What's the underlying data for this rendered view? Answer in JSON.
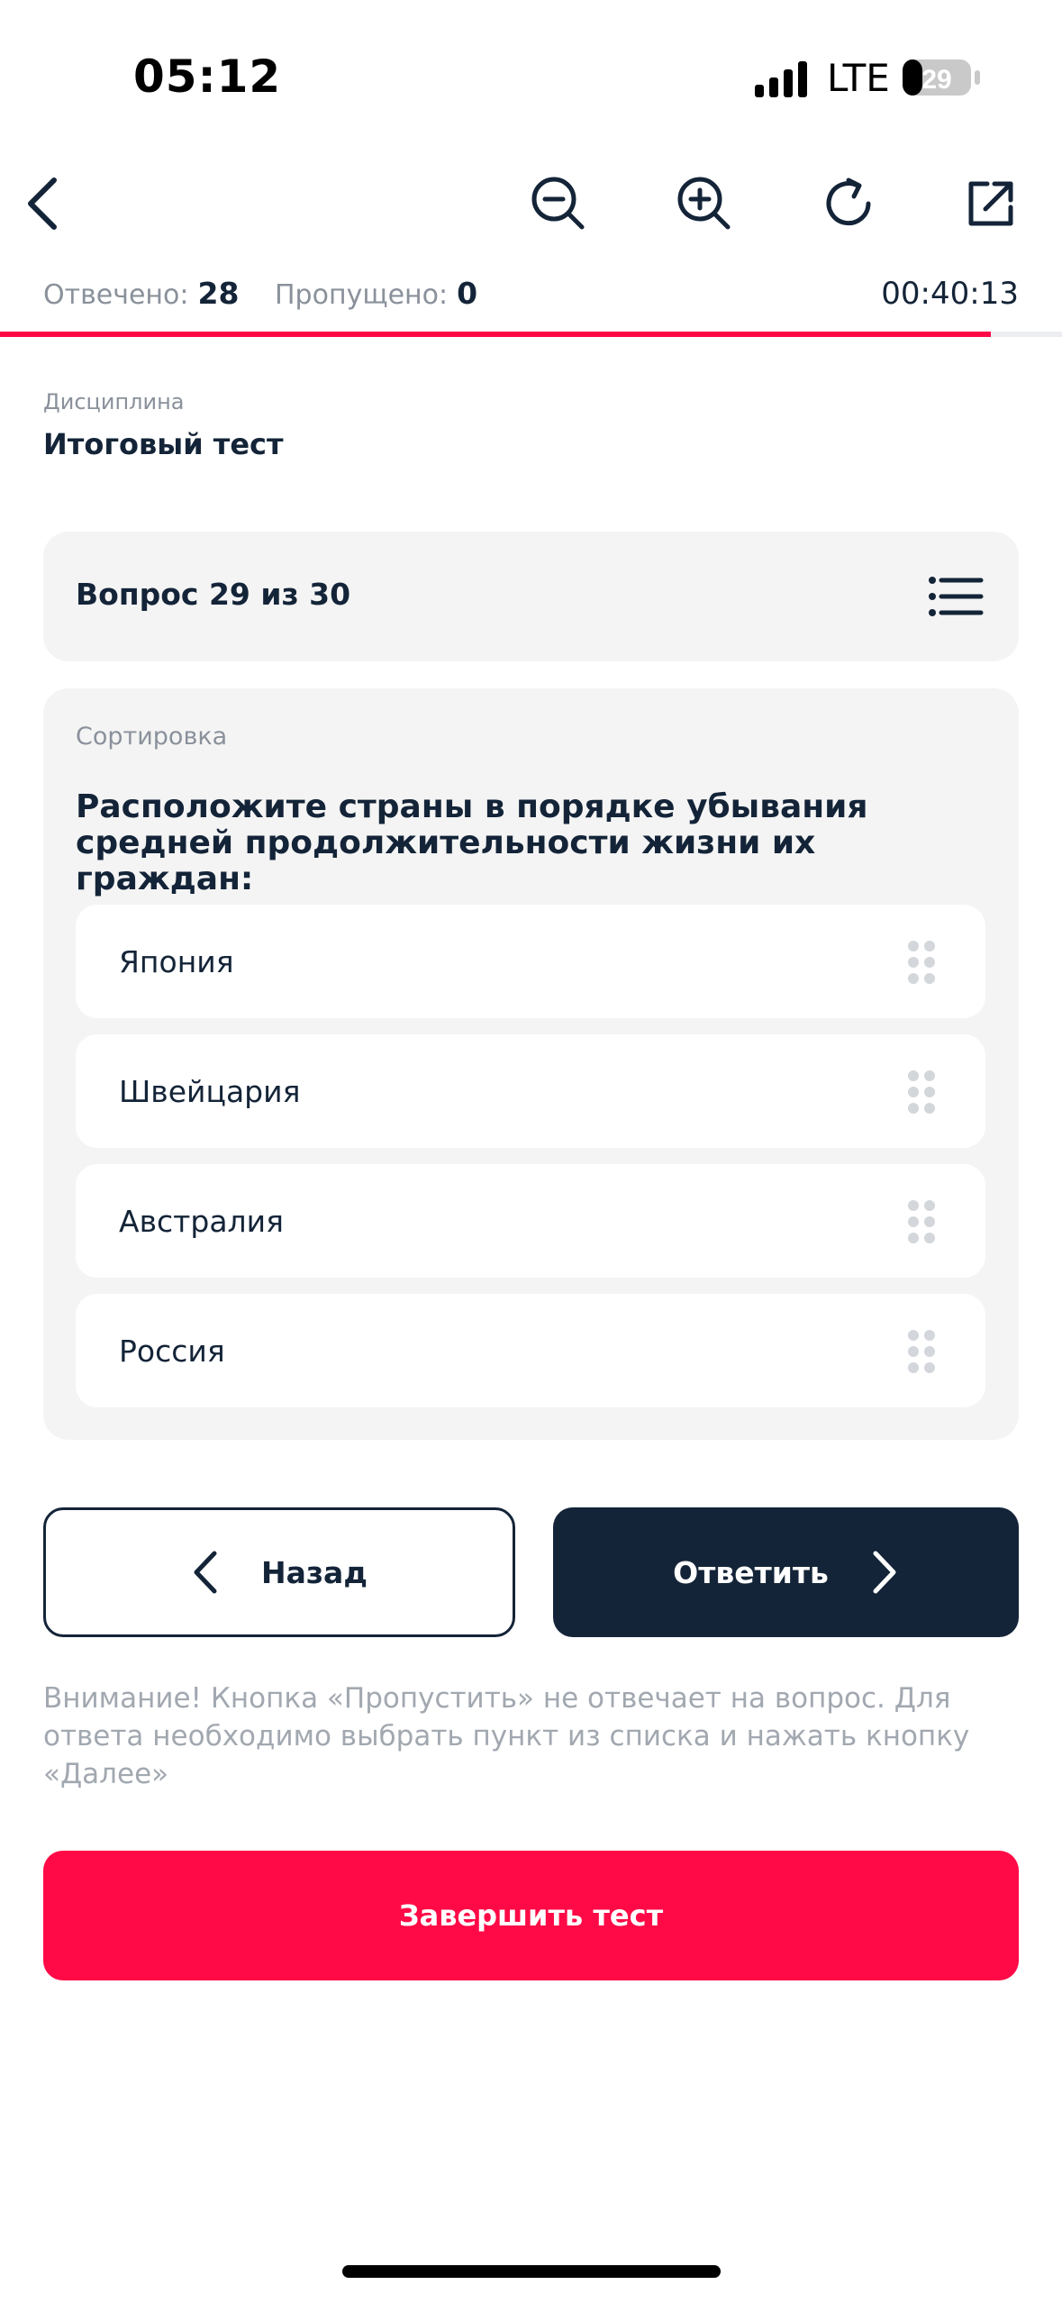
{
  "status_bar": {
    "time": "05:12",
    "network": "LTE",
    "battery": "29"
  },
  "toolbar": {
    "icons": [
      "back-icon",
      "zoom-out-icon",
      "zoom-in-icon",
      "refresh-icon",
      "share-icon"
    ]
  },
  "stats": {
    "answered_label": "Отвечено:",
    "answered_value": "28",
    "skipped_label": "Пропущено:",
    "skipped_value": "0",
    "timer": "00:40:13",
    "progress": 0.933
  },
  "discipline": {
    "label": "Дисциплина",
    "title": "Итоговый тест"
  },
  "question": {
    "number_text": "Вопрос 29 из 30",
    "type": "Сортировка",
    "text": "Расположите страны в порядке убывания средней продолжительности жизни их граждан:",
    "options": [
      {
        "label": "Япония"
      },
      {
        "label": "Швейцария"
      },
      {
        "label": "Австралия"
      },
      {
        "label": "Россия"
      }
    ]
  },
  "buttons": {
    "back": "Назад",
    "answer": "Ответить",
    "finish": "Завершить тест"
  },
  "warning": "Внимание! Кнопка «Пропустить» не отвечает на вопрос. Для ответа необходимо выбрать пункт из списка и нажать кнопку «Далее»",
  "colors": {
    "accent": "#ff0a47",
    "dark": "#142438",
    "card_bg": "#f4f4f4",
    "muted": "#8a919b"
  }
}
